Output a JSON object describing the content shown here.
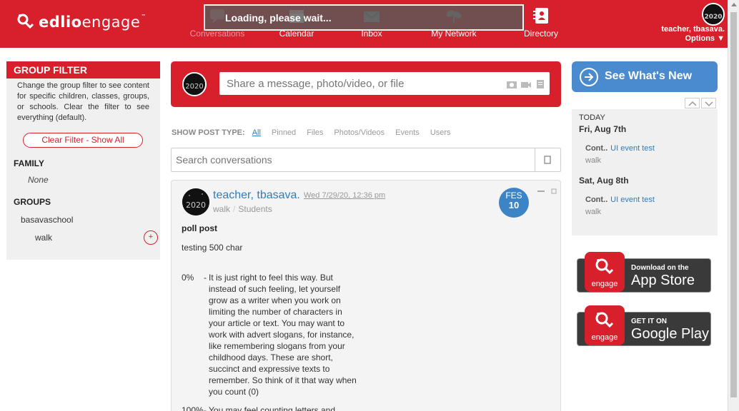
{
  "header": {
    "logo_bold": "edlio",
    "logo_light": "engage",
    "logo_tm": "™",
    "loading": "Loading, please wait...",
    "nav": [
      {
        "label": "Conversations",
        "icon": "chat-icon"
      },
      {
        "label": "Calendar",
        "icon": "calendar-icon"
      },
      {
        "label": "Inbox",
        "icon": "envelope-icon"
      },
      {
        "label": "My Network",
        "icon": "network-icon"
      },
      {
        "label": "Directory",
        "icon": "directory-icon"
      }
    ],
    "user_name": "teacher, tbasava.",
    "options": "Options ▼",
    "brand_color": "#d7202b"
  },
  "group_filter": {
    "title": "GROUP FILTER",
    "description": "Change the group filter to see content for specific children, classes, groups, or schools. Clear the filter to see everything (default).",
    "clear_button": "Clear Filter - Show All",
    "family_heading": "FAMILY",
    "family_value": "None",
    "groups_heading": "GROUPS",
    "groups": [
      "basavaschool",
      "walk"
    ],
    "add_symbol": "+"
  },
  "composer": {
    "placeholder": "Share a message, photo/video, or file"
  },
  "post_types": {
    "label": "SHOW POST TYPE:",
    "options": [
      "All",
      "Pinned",
      "Files",
      "Photos/Videos",
      "Events",
      "Users"
    ],
    "active": "All"
  },
  "search": {
    "placeholder": "Search conversations"
  },
  "post": {
    "author": "teacher, tbasava.",
    "date": "Wed 7/29/20, 12:36 pm",
    "group": "walk",
    "audience": "Students",
    "separator": "/",
    "badge_month": "FES",
    "badge_day": "10",
    "title": "poll post",
    "body": "testing 500 char",
    "poll": [
      {
        "pct": "0%",
        "dash": "-",
        "text": "It is just right to feel this way. But instead of such feeling, let yourself grow as a writer when you work on limiting the number of characters in your article or text. You may want to work with advert slogans, for instance, like remembering slogans from your childhood days. These are short, succinct and expressive texts to remember. So think of it that way when you count (0)"
      },
      {
        "pct": "100%",
        "dash": "-",
        "text": "You may feel counting letters and"
      }
    ]
  },
  "right": {
    "whats_new": "See What's New",
    "today": "TODAY",
    "events": [
      {
        "date": "Fri, Aug 7th",
        "cont": "Cont..",
        "title": "UI event test",
        "group": "walk"
      },
      {
        "date": "Sat, Aug 8th",
        "cont": "Cont..",
        "title": "UI event test",
        "group": "walk"
      }
    ],
    "app_store": {
      "small": "Download on the",
      "big": "App Store",
      "word": "engage"
    },
    "google_play": {
      "small": "GET IT ON",
      "big": "Google Play",
      "word": "engage"
    }
  },
  "avatar_text": "2020"
}
